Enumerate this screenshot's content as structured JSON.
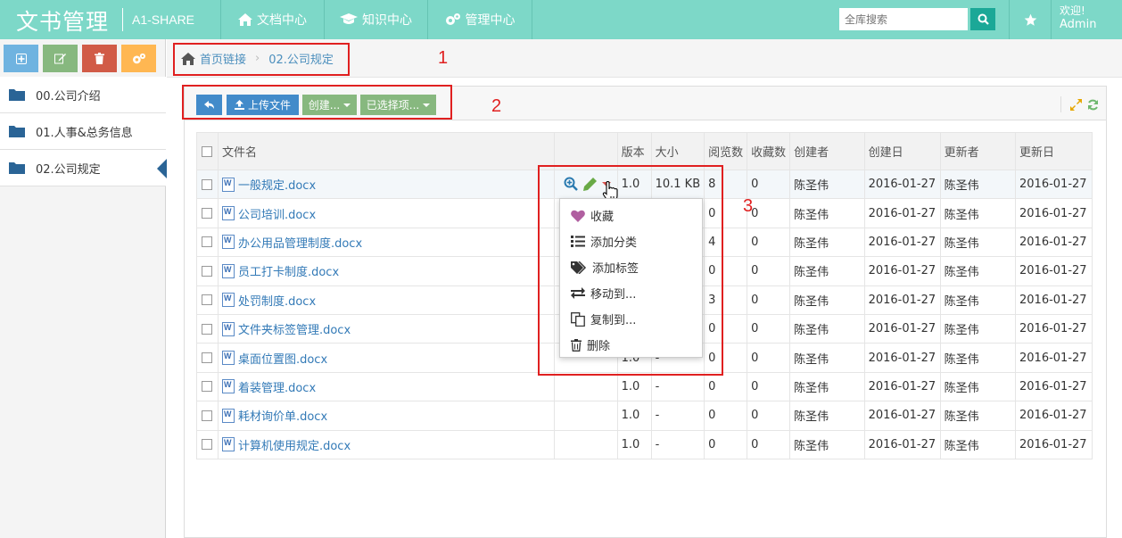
{
  "header": {
    "brand": "文书管理",
    "brand_sub": "A1-SHARE",
    "nav": [
      {
        "label": "文档中心",
        "icon": "home-icon"
      },
      {
        "label": "知识中心",
        "icon": "graduation-cap-icon"
      },
      {
        "label": "管理中心",
        "icon": "cogs-icon"
      }
    ],
    "search_placeholder": "全库搜索",
    "welcome": "欢迎!",
    "username": "Admin",
    "accent_color": "#7dd8c8"
  },
  "sidebar": {
    "items": [
      {
        "label": "00.公司介绍",
        "active": false
      },
      {
        "label": "01.人事&总务信息",
        "active": false
      },
      {
        "label": "02.公司规定",
        "active": true
      }
    ]
  },
  "breadcrumb": {
    "home": "首页链接",
    "current": "02.公司规定"
  },
  "toolbar": {
    "upload_label": "上传文件",
    "create_label": "创建...",
    "selected_label": "已选择项..."
  },
  "annotations": [
    "1",
    "2",
    "3"
  ],
  "table": {
    "headers": [
      "文件名",
      "",
      "版本",
      "大小",
      "阅览数",
      "收藏数",
      "创建者",
      "创建日",
      "更新者",
      "更新日"
    ],
    "rows": [
      {
        "name": "一般规定.docx",
        "version": "1.0",
        "size": "10.1 KB",
        "views": "8",
        "favs": "0",
        "creator": "陈圣伟",
        "created": "2016-01-27",
        "updater": "陈圣伟",
        "updated": "2016-01-27"
      },
      {
        "name": "公司培训.docx",
        "version": "",
        "size": "",
        "views": "0",
        "favs": "0",
        "creator": "陈圣伟",
        "created": "2016-01-27",
        "updater": "陈圣伟",
        "updated": "2016-01-27"
      },
      {
        "name": "办公用品管理制度.docx",
        "version": "",
        "size": "",
        "views": "4",
        "favs": "0",
        "creator": "陈圣伟",
        "created": "2016-01-27",
        "updater": "陈圣伟",
        "updated": "2016-01-27"
      },
      {
        "name": "员工打卡制度.docx",
        "version": "",
        "size": "",
        "views": "0",
        "favs": "0",
        "creator": "陈圣伟",
        "created": "2016-01-27",
        "updater": "陈圣伟",
        "updated": "2016-01-27"
      },
      {
        "name": "处罚制度.docx",
        "version": "",
        "size": "",
        "views": "3",
        "favs": "0",
        "creator": "陈圣伟",
        "created": "2016-01-27",
        "updater": "陈圣伟",
        "updated": "2016-01-27"
      },
      {
        "name": "文件夹标签管理.docx",
        "version": "",
        "size": "",
        "views": "0",
        "favs": "0",
        "creator": "陈圣伟",
        "created": "2016-01-27",
        "updater": "陈圣伟",
        "updated": "2016-01-27"
      },
      {
        "name": "桌面位置图.docx",
        "version": "1.0",
        "size": "-",
        "views": "0",
        "favs": "0",
        "creator": "陈圣伟",
        "created": "2016-01-27",
        "updater": "陈圣伟",
        "updated": "2016-01-27"
      },
      {
        "name": "着装管理.docx",
        "version": "1.0",
        "size": "-",
        "views": "0",
        "favs": "0",
        "creator": "陈圣伟",
        "created": "2016-01-27",
        "updater": "陈圣伟",
        "updated": "2016-01-27"
      },
      {
        "name": "耗材询价单.docx",
        "version": "1.0",
        "size": "-",
        "views": "0",
        "favs": "0",
        "creator": "陈圣伟",
        "created": "2016-01-27",
        "updater": "陈圣伟",
        "updated": "2016-01-27"
      },
      {
        "name": "计算机使用规定.docx",
        "version": "1.0",
        "size": "-",
        "views": "0",
        "favs": "0",
        "creator": "陈圣伟",
        "created": "2016-01-27",
        "updater": "陈圣伟",
        "updated": "2016-01-27"
      }
    ]
  },
  "context_menu": {
    "items": [
      {
        "label": "收藏",
        "icon": "heart-icon"
      },
      {
        "label": "添加分类",
        "icon": "list-icon"
      },
      {
        "label": "添加标签",
        "icon": "tags-icon"
      },
      {
        "label": "移动到...",
        "icon": "exchange-icon"
      },
      {
        "label": "复制到...",
        "icon": "copy-icon"
      },
      {
        "label": "删除",
        "icon": "trash-icon"
      }
    ]
  }
}
